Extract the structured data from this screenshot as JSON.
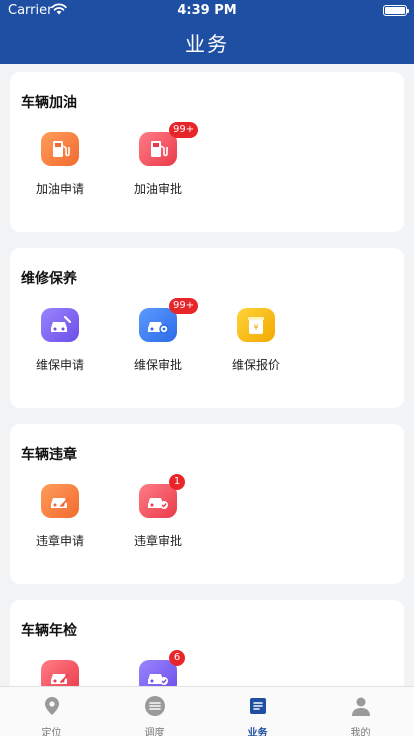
{
  "status_bar": {
    "carrier": "Carrier",
    "time": "4:39 PM"
  },
  "header": {
    "title": "业务"
  },
  "sections": [
    {
      "title": "车辆加油",
      "items": [
        {
          "label": "加油申请",
          "icon": "fuel-pump-icon",
          "color": "#f26a2e",
          "badge": ""
        },
        {
          "label": "加油审批",
          "icon": "fuel-pump-icon",
          "color": "#e93b4b",
          "badge": "99+"
        }
      ]
    },
    {
      "title": "维修保养",
      "items": [
        {
          "label": "维保申请",
          "icon": "car-wrench-icon",
          "color": "#6a4ee8",
          "badge": ""
        },
        {
          "label": "维保审批",
          "icon": "car-gear-icon",
          "color": "#2d6ae8",
          "badge": "99+"
        },
        {
          "label": "维保报价",
          "icon": "price-quote-icon",
          "color": "#f3a800",
          "badge": ""
        }
      ]
    },
    {
      "title": "车辆违章",
      "items": [
        {
          "label": "违章申请",
          "icon": "car-edit-icon",
          "color": "#f26a2e",
          "badge": ""
        },
        {
          "label": "违章审批",
          "icon": "car-approve-icon",
          "color": "#e93b4b",
          "badge": "1"
        }
      ]
    },
    {
      "title": "车辆年检",
      "items": [
        {
          "label": "",
          "icon": "car-edit-icon",
          "color": "#e93b4b",
          "badge": ""
        },
        {
          "label": "",
          "icon": "car-approve-icon",
          "color": "#6a4ee8",
          "badge": "6"
        }
      ]
    }
  ],
  "tabbar": {
    "tabs": [
      {
        "label": "定位",
        "icon": "location-pin-icon",
        "active": false
      },
      {
        "label": "调度",
        "icon": "dispatch-icon",
        "active": false
      },
      {
        "label": "业务",
        "icon": "business-icon",
        "active": true
      },
      {
        "label": "我的",
        "icon": "user-icon",
        "active": false
      }
    ],
    "active_color": "#1f4fa3"
  }
}
